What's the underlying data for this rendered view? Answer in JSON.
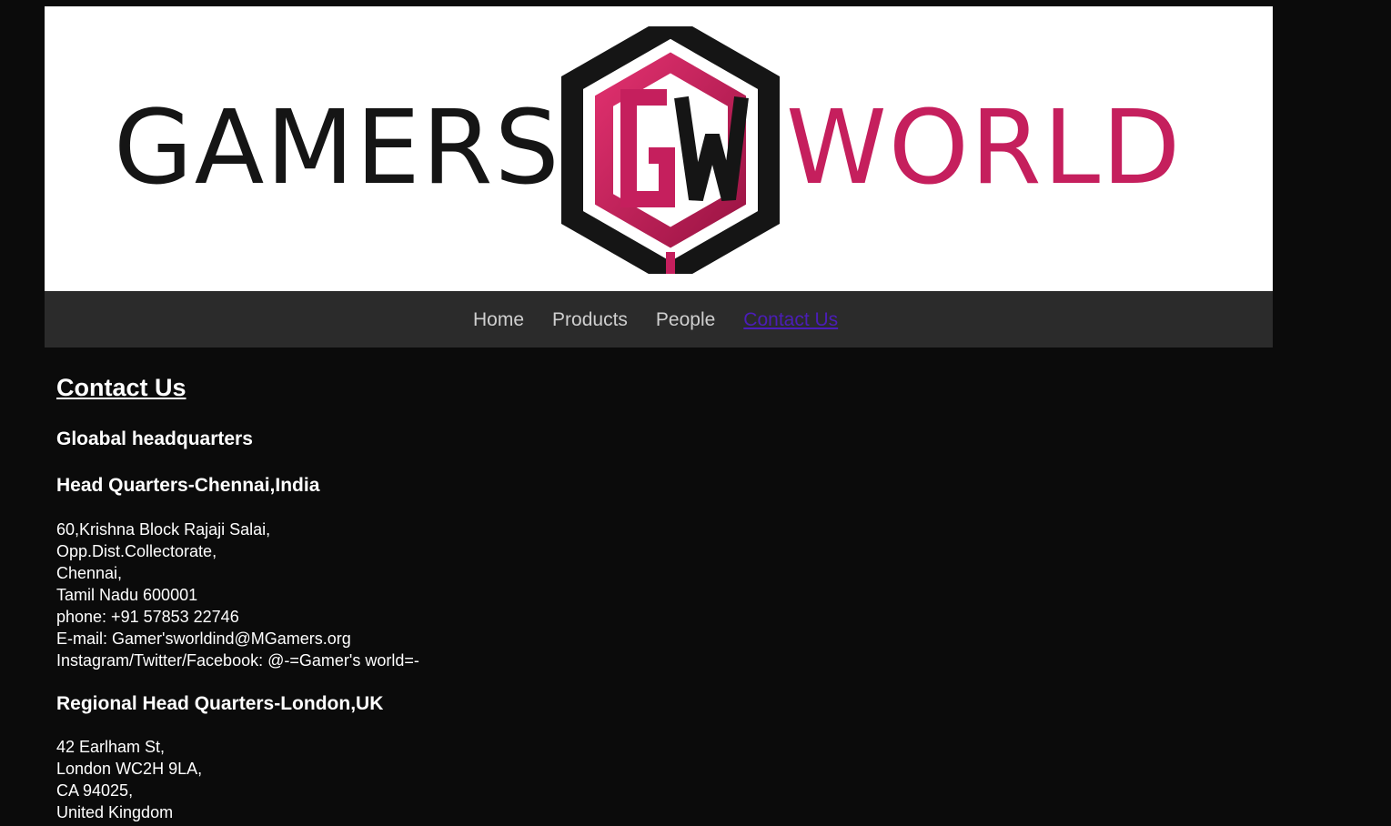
{
  "logo": {
    "left_text": "GAMERS",
    "monogram": "GW",
    "right_text": "WORLD",
    "colors": {
      "dark": "#151515",
      "accent": "#c51f5d"
    }
  },
  "nav": {
    "items": [
      {
        "label": "Home",
        "active": false
      },
      {
        "label": "Products",
        "active": false
      },
      {
        "label": "People",
        "active": false
      },
      {
        "label": "Contact Us",
        "active": true
      }
    ],
    "colors": {
      "default": "#cfcfcf",
      "active": "#4b1db8"
    }
  },
  "content": {
    "title": "Contact Us",
    "section_heading": "Gloabal headquarters",
    "offices": [
      {
        "heading": "Head Quarters-Chennai,India",
        "lines": [
          "60,Krishna Block Rajaji Salai,",
          "Opp.Dist.Collectorate,",
          "Chennai,",
          "Tamil Nadu 600001",
          "phone: +91 57853 22746",
          "E-mail: Gamer'sworldind@MGamers.org",
          "Instagram/Twitter/Facebook: @-=Gamer's world=-"
        ]
      },
      {
        "heading": "Regional Head Quarters-London,UK",
        "lines": [
          "42 Earlham St,",
          "London WC2H 9LA,",
          "CA 94025,",
          "United Kingdom"
        ]
      }
    ]
  }
}
